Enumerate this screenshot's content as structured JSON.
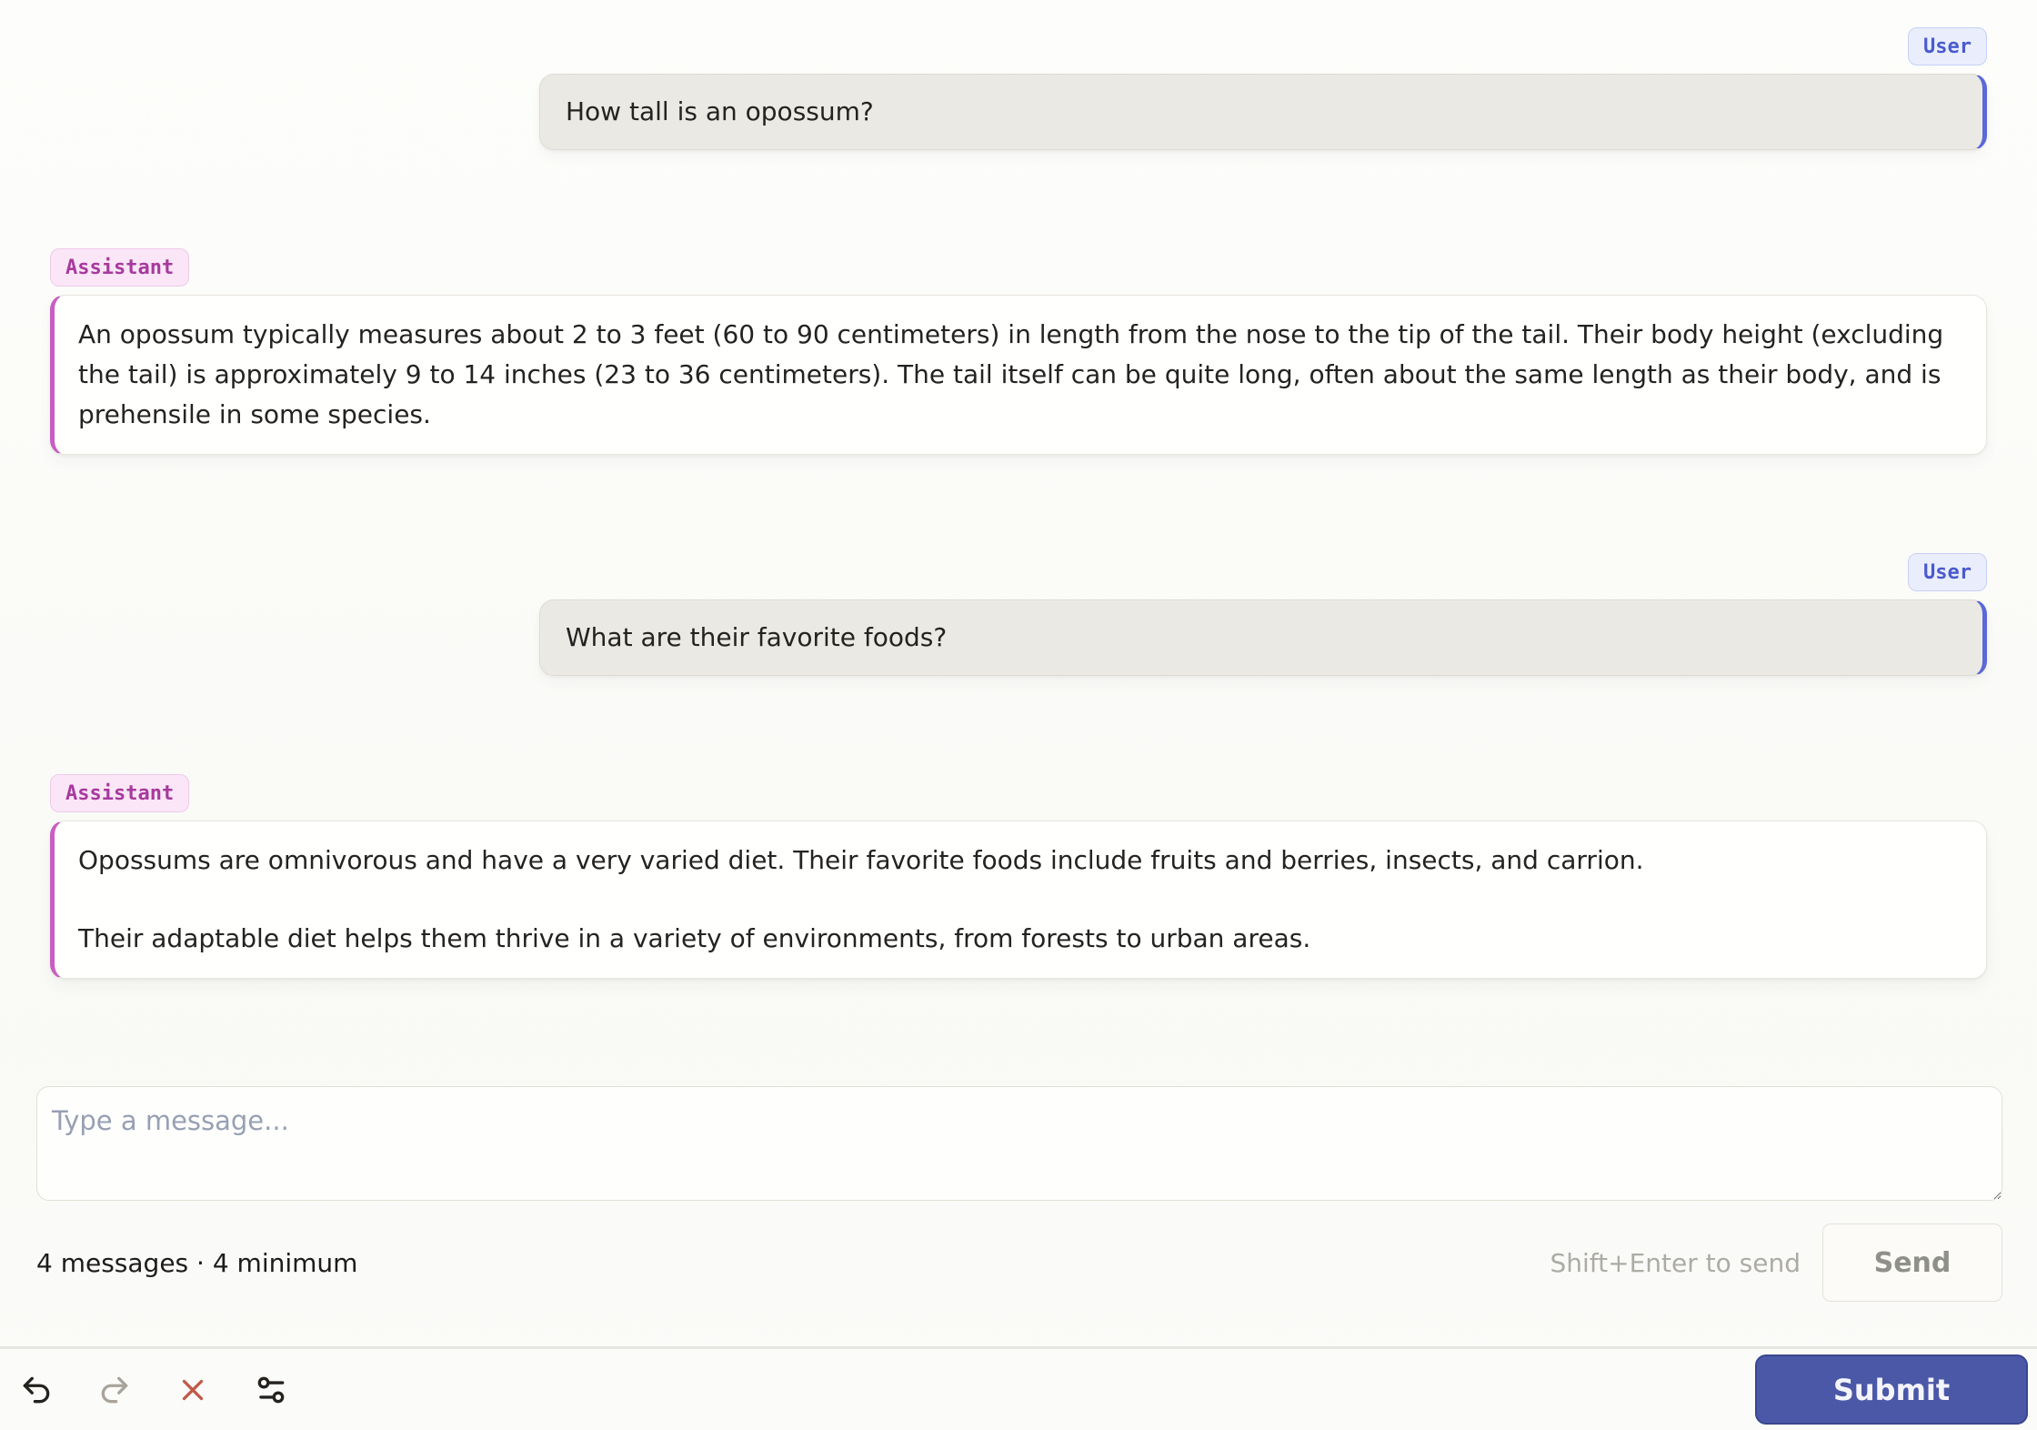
{
  "conversation": [
    {
      "role": "User",
      "text": "How tall is an opossum?"
    },
    {
      "role": "Assistant",
      "paragraphs": [
        "An opossum typically measures about 2 to 3 feet (60 to 90 centimeters) in length from the nose to the tip of the tail. Their body height (excluding the tail) is approximately 9 to 14 inches (23 to 36 centimeters). The tail itself can be quite long, often about the same length as their body, and is prehensile in some species."
      ]
    },
    {
      "role": "User",
      "text": "What are their favorite foods?"
    },
    {
      "role": "Assistant",
      "paragraphs": [
        "Opossums are omnivorous and have a very varied diet. Their favorite foods include fruits and berries, insects, and carrion.",
        "Their adaptable diet helps them thrive in a variety of environments, from forests to urban areas."
      ]
    }
  ],
  "composer": {
    "placeholder": "Type a message...",
    "value": "",
    "status": "4 messages · 4 minimum",
    "hint": "Shift+Enter to send",
    "send_label": "Send"
  },
  "footer": {
    "submit_label": "Submit",
    "icons": [
      "undo-icon",
      "redo-icon",
      "clear-icon",
      "settings-sliders-icon"
    ]
  },
  "colors": {
    "user_accent": "#5a68d8",
    "user_badge_text": "#4a5ace",
    "user_badge_bg": "#eaeefc",
    "user_bubble_bg": "#ebe9e4",
    "assistant_accent": "#c75fc2",
    "assistant_badge_text": "#a73a9d",
    "assistant_badge_bg": "#fae6f7",
    "submit_bg": "#4b58a7",
    "clear_icon": "#bf5a49",
    "disabled_icon": "#a8a39b"
  }
}
